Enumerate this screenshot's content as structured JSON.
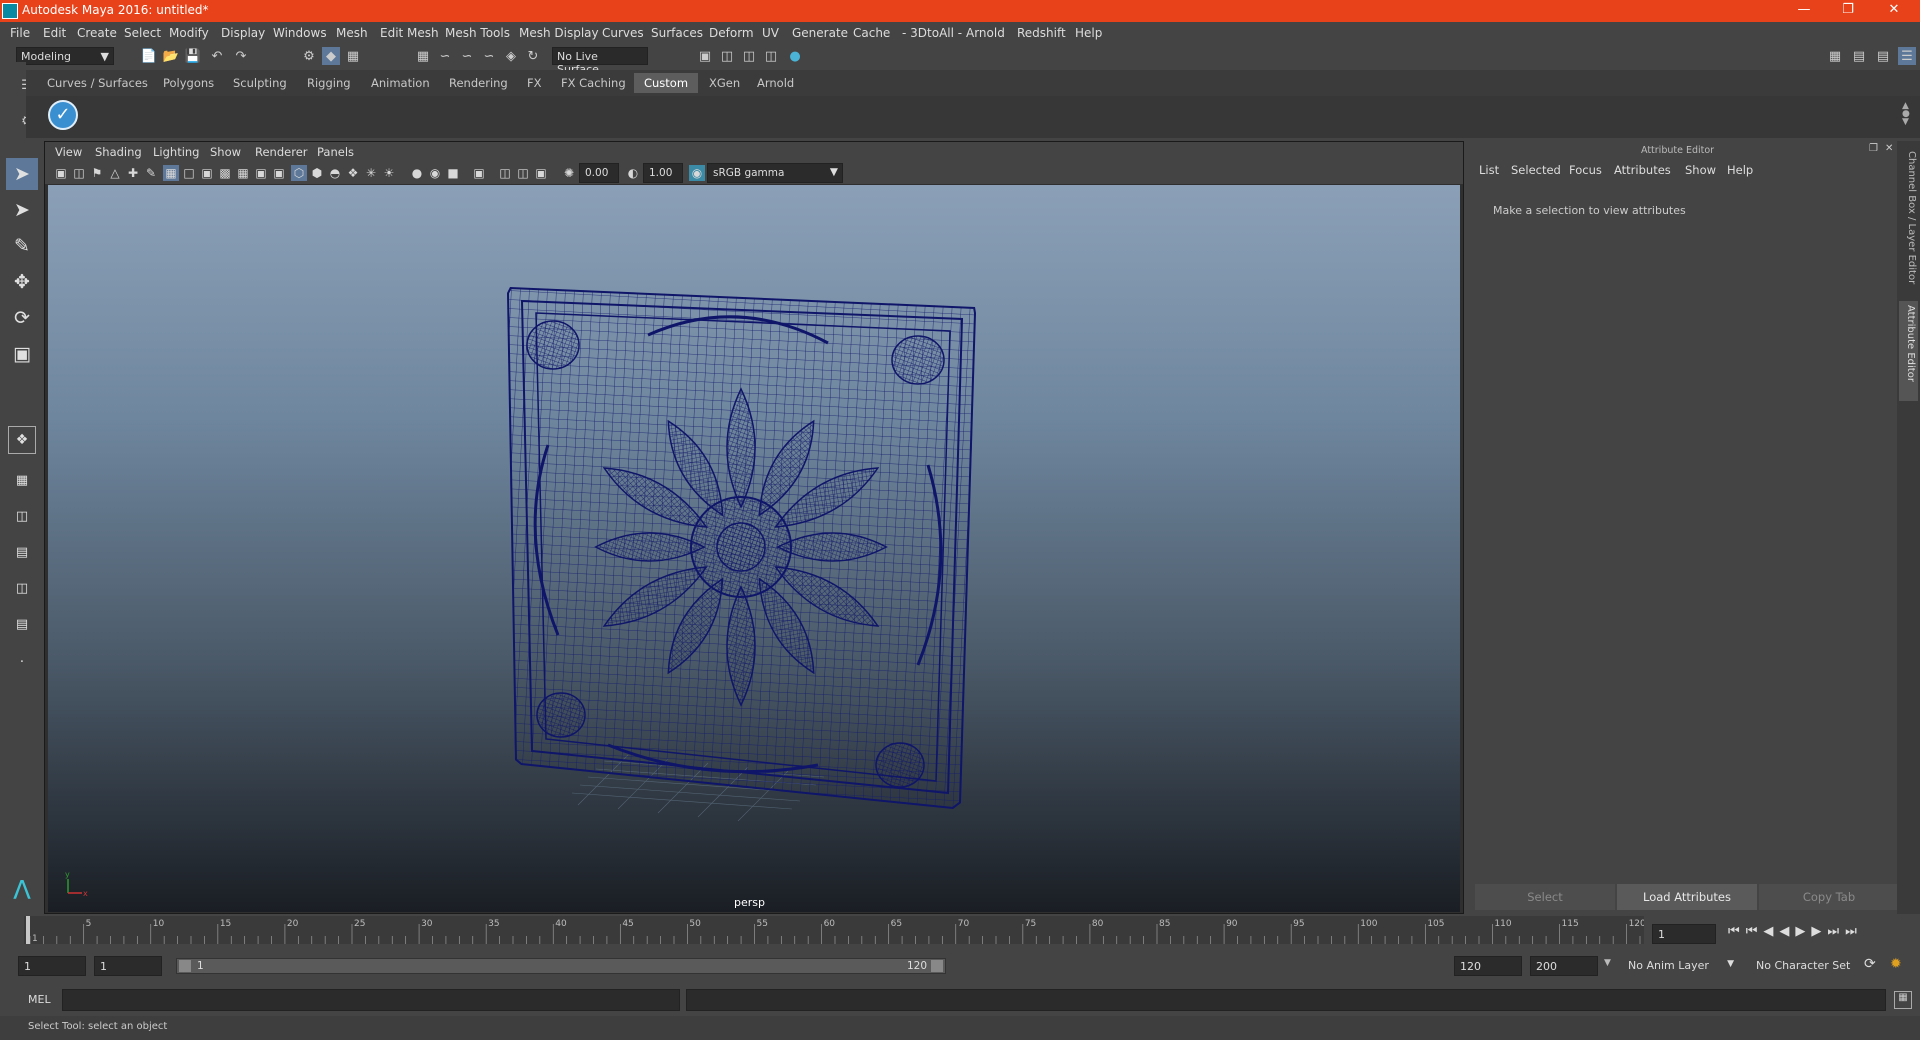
{
  "app": {
    "title": "Autodesk Maya 2016: untitled*"
  },
  "menu": [
    "File",
    "Edit",
    "Create",
    "Select",
    "Modify",
    "Display",
    "Windows",
    "Mesh",
    "Edit Mesh",
    "Mesh Tools",
    "Mesh Display",
    "Curves",
    "Surfaces",
    "Deform",
    "UV",
    "Generate",
    "Cache",
    "- 3DtoAll -",
    "Arnold",
    "Redshift",
    "Help"
  ],
  "status": {
    "mode": "Modeling",
    "live_surface": "No Live Surface"
  },
  "shelf_tabs": [
    "Curves / Surfaces",
    "Polygons",
    "Sculpting",
    "Rigging",
    "Animation",
    "Rendering",
    "FX",
    "FX Caching",
    "Custom",
    "XGen",
    "Arnold"
  ],
  "active_shelf_tab": "Custom",
  "viewport": {
    "menu": [
      "View",
      "Shading",
      "Lighting",
      "Show",
      "Renderer",
      "Panels"
    ],
    "exposure": "0.00",
    "gamma": "1.00",
    "color_space": "sRGB gamma",
    "camera_label": "persp"
  },
  "attribute_editor": {
    "title": "Attribute Editor",
    "menu": [
      "List",
      "Selected",
      "Focus",
      "Attributes",
      "Show",
      "Help"
    ],
    "message": "Make a selection to view attributes",
    "buttons": {
      "select": "Select",
      "load": "Load Attributes",
      "copy": "Copy Tab"
    }
  },
  "side_tabs": {
    "channel": "Channel Box / Layer Editor",
    "attr": "Attribute Editor"
  },
  "timeline": {
    "ticks": [
      "1",
      "5",
      "10",
      "15",
      "20",
      "25",
      "30",
      "35",
      "40",
      "45",
      "50",
      "55",
      "60",
      "65",
      "70",
      "75",
      "80",
      "85",
      "90",
      "95",
      "100",
      "105",
      "110",
      "115",
      "120"
    ],
    "current_frame": "1"
  },
  "range": {
    "start": "1",
    "playback_start": "1",
    "slider_start": "1",
    "slider_end": "120",
    "playback_end": "120",
    "end": "200",
    "anim_layer": "No Anim Layer",
    "character_set": "No Character Set"
  },
  "command": {
    "label": "MEL"
  },
  "help_line": "Select Tool: select an object"
}
